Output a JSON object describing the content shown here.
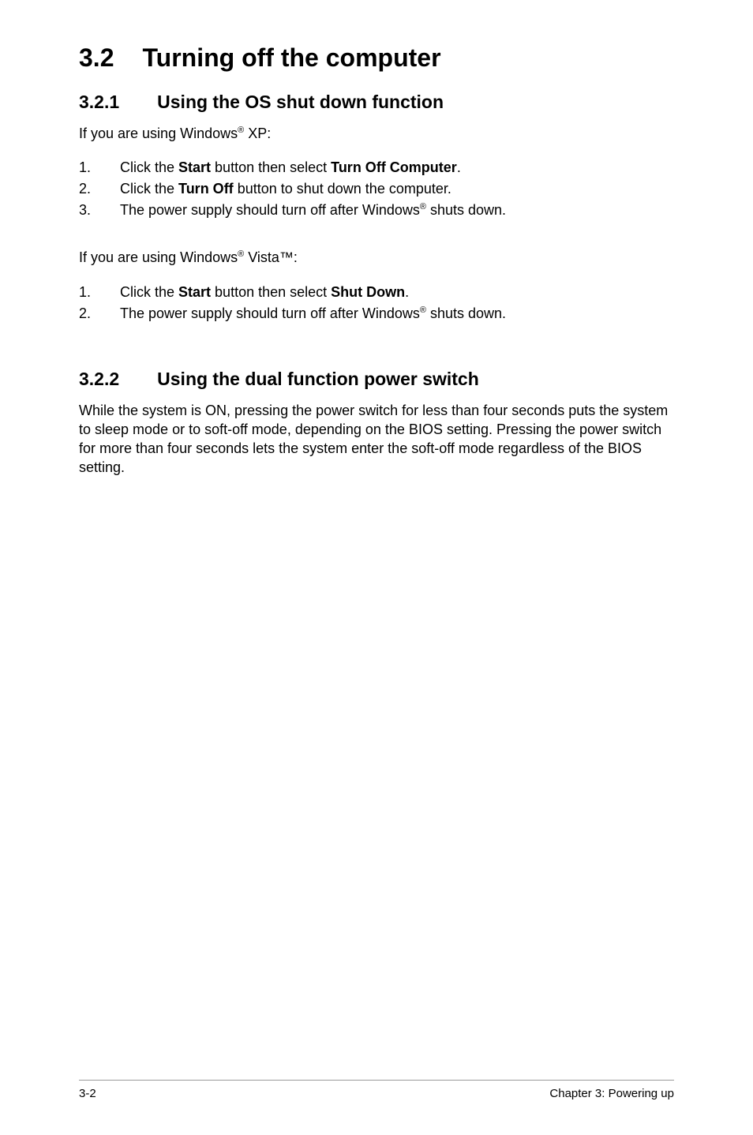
{
  "section": {
    "number": "3.2",
    "title": "Turning off the computer"
  },
  "sub1": {
    "number": "3.2.1",
    "title": "Using the OS shut down function",
    "introXP_pre": "If you are using Windows",
    "introXP_post": " XP:",
    "xpSteps": [
      {
        "num": "1.",
        "pre": "Click the ",
        "b1": "Start",
        "mid": " button then select ",
        "b2": "Turn Off Computer",
        "post": "."
      },
      {
        "num": "2.",
        "pre": "Click the ",
        "b1": "Turn Off",
        "mid": " button to shut down the computer.",
        "b2": "",
        "post": ""
      },
      {
        "num": "3.",
        "pre": "The power supply should turn off after Windows",
        "sup": "®",
        "post": " shuts down."
      }
    ],
    "introVista_pre": "If you are using Windows",
    "introVista_post": " Vista™:",
    "vistaSteps": [
      {
        "num": "1.",
        "pre": "Click the ",
        "b1": "Start",
        "mid": " button then select ",
        "b2": "Shut Down",
        "post": "."
      },
      {
        "num": "2.",
        "pre": "The power supply should turn off after Windows",
        "sup": "®",
        "post": " shuts down."
      }
    ]
  },
  "sub2": {
    "number": "3.2.2",
    "title": "Using the dual function power switch",
    "body": "While the system is ON, pressing the power switch for less than four seconds puts the system to sleep mode or to soft-off mode, depending on the BIOS setting. Pressing the power switch for more than four seconds lets the system enter the soft-off mode regardless of the BIOS setting."
  },
  "footer": {
    "pageNum": "3-2",
    "chapter": "Chapter 3: Powering up"
  }
}
